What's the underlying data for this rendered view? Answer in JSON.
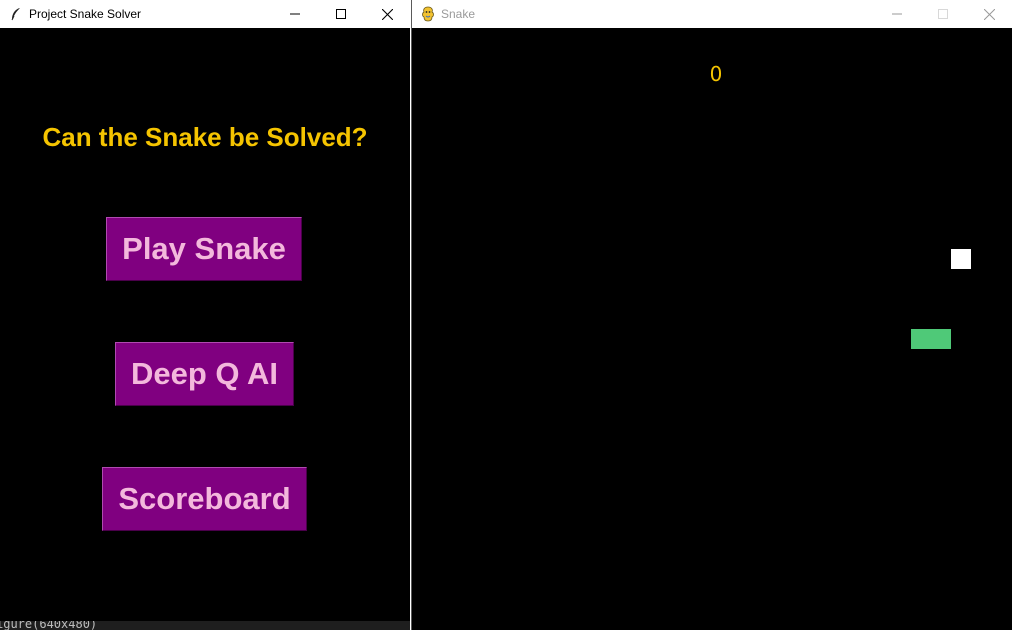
{
  "left_window": {
    "title": "Project Snake Solver",
    "icon": "feather-icon",
    "headline": "Can the Snake be Solved?",
    "buttons": {
      "play": "Play Snake",
      "deepq": "Deep Q AI",
      "scoreboard": "Scoreboard"
    },
    "status_text": "igure(640x480)"
  },
  "right_window": {
    "title": "Snake",
    "icon": "pygame-icon",
    "score": "0"
  },
  "colors": {
    "headline": "#f5c400",
    "button_bg": "#800080",
    "button_text": "#f3b8dc",
    "snake": "#4fc978",
    "food": "#ffffff",
    "score": "#f5c400"
  }
}
